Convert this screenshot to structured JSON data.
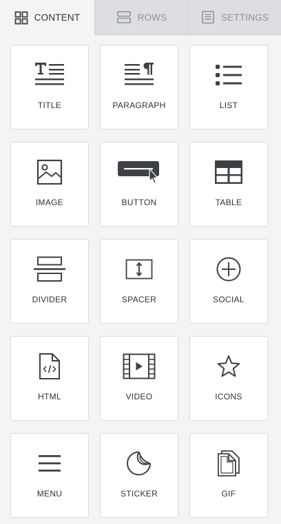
{
  "tabs": [
    {
      "label": "CONTENT",
      "icon": "grid-icon",
      "active": true
    },
    {
      "label": "ROWS",
      "icon": "rows-icon",
      "active": false
    },
    {
      "label": "SETTINGS",
      "icon": "settings-doc-icon",
      "active": false
    }
  ],
  "blocks": [
    {
      "label": "TITLE",
      "icon": "title-icon"
    },
    {
      "label": "PARAGRAPH",
      "icon": "paragraph-icon"
    },
    {
      "label": "LIST",
      "icon": "list-icon"
    },
    {
      "label": "IMAGE",
      "icon": "image-icon"
    },
    {
      "label": "BUTTON",
      "icon": "button-icon"
    },
    {
      "label": "TABLE",
      "icon": "table-icon"
    },
    {
      "label": "DIVIDER",
      "icon": "divider-icon"
    },
    {
      "label": "SPACER",
      "icon": "spacer-icon"
    },
    {
      "label": "SOCIAL",
      "icon": "social-plus-icon"
    },
    {
      "label": "HTML",
      "icon": "html-file-icon"
    },
    {
      "label": "VIDEO",
      "icon": "video-icon"
    },
    {
      "label": "ICONS",
      "icon": "star-icon"
    },
    {
      "label": "MENU",
      "icon": "menu-icon"
    },
    {
      "label": "STICKER",
      "icon": "sticker-icon"
    },
    {
      "label": "GIF",
      "icon": "gif-file-icon"
    }
  ],
  "colors": {
    "icon": "#3d4145",
    "tab_active_bg": "#f4f4f5",
    "tab_inactive_bg": "#dcdee1",
    "tab_inactive_text": "#8e9398",
    "tile_border": "#d8dbdf"
  }
}
